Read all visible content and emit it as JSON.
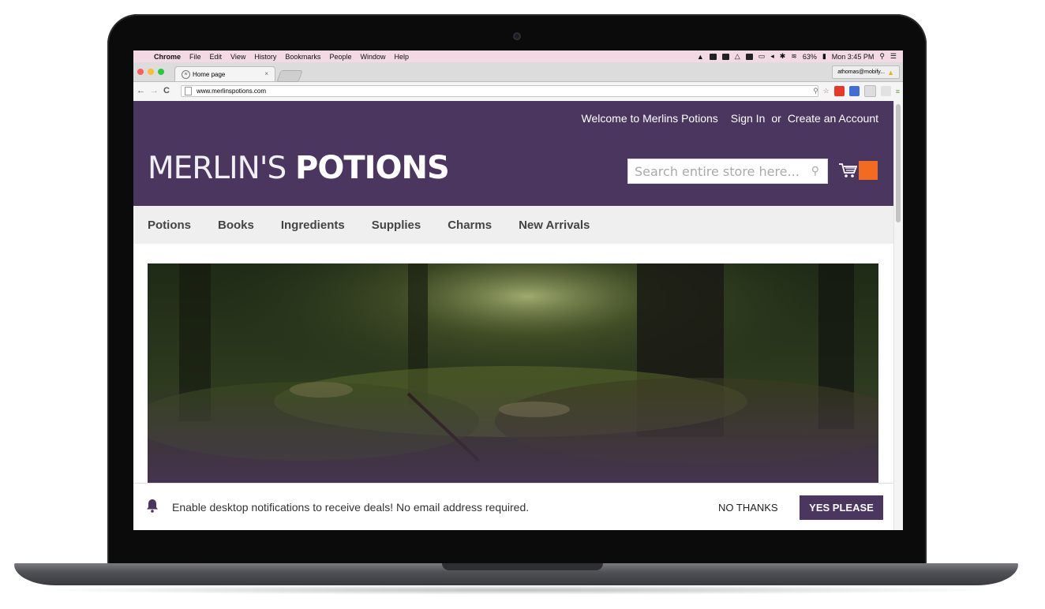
{
  "menubar": {
    "app": "Chrome",
    "items": [
      "File",
      "Edit",
      "View",
      "History",
      "Bookmarks",
      "People",
      "Window",
      "Help"
    ],
    "battery": "63%",
    "clock": "Mon 3:45 PM"
  },
  "browser": {
    "tab_title": "Home page",
    "tab_close": "×",
    "profile": "athomas@mobify...",
    "url": "www.merlinspotions.com"
  },
  "site": {
    "welcome": "Welcome to Merlins Potions",
    "sign_in": "Sign In",
    "or": "or",
    "create_account": "Create an Account",
    "logo_light": "MERLIN'S",
    "logo_bold": "POTIONS",
    "search_placeholder": "Search entire store here...",
    "nav": [
      "Potions",
      "Books",
      "Ingredients",
      "Supplies",
      "Charms",
      "New Arrivals"
    ]
  },
  "notification": {
    "message": "Enable desktop notifications to receive deals! No email address required.",
    "no_label": "NO THANKS",
    "yes_label": "YES PLEASE"
  },
  "colors": {
    "brand_purple": "#4a365f",
    "accent_orange": "#f26b21"
  }
}
